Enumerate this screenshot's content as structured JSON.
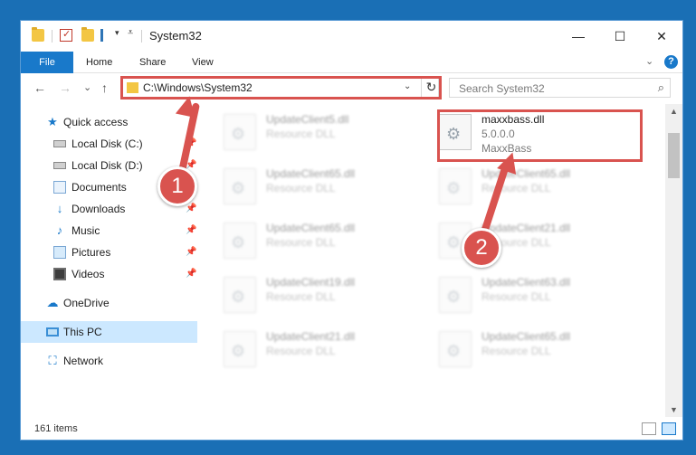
{
  "window": {
    "title": "System32",
    "controls": {
      "minimize": "—",
      "maximize": "☐",
      "close": "✕"
    }
  },
  "ribbon": {
    "tabs": [
      "File",
      "Home",
      "Share",
      "View"
    ],
    "chevron": "⌄",
    "help": "?"
  },
  "navbar": {
    "back": "←",
    "forward": "→",
    "recent": "⌄",
    "up": "↑",
    "address": "C:\\Windows\\System32",
    "address_dropdown": "⌄",
    "refresh": "↻",
    "search_placeholder": "Search System32",
    "search_icon": "⌕"
  },
  "sidebar": {
    "items": [
      {
        "label": "Quick access",
        "icon": "star-icon",
        "glyph": "★"
      },
      {
        "label": "Local Disk (C:)",
        "icon": "drive-icon",
        "glyph": "",
        "pinned": true
      },
      {
        "label": "Local Disk (D:)",
        "icon": "drive-icon",
        "glyph": "",
        "pinned": true
      },
      {
        "label": "Documents",
        "icon": "documents-icon",
        "glyph": "",
        "pinned": true
      },
      {
        "label": "Downloads",
        "icon": "download-icon",
        "glyph": "↓",
        "pinned": true
      },
      {
        "label": "Music",
        "icon": "music-icon",
        "glyph": "♪",
        "pinned": true
      },
      {
        "label": "Pictures",
        "icon": "pictures-icon",
        "glyph": "",
        "pinned": true
      },
      {
        "label": "Videos",
        "icon": "videos-icon",
        "glyph": "",
        "pinned": true
      },
      {
        "label": "OneDrive",
        "icon": "cloud-icon",
        "glyph": "☁"
      },
      {
        "label": "This PC",
        "icon": "computer-icon",
        "glyph": "",
        "selected": true
      },
      {
        "label": "Network",
        "icon": "network-icon",
        "glyph": "⛶"
      }
    ],
    "pin_glyph": "📌"
  },
  "files": {
    "left": [
      {
        "name": "UpdateClient5.dll",
        "type": "Resource DLL"
      },
      {
        "name": "UpdateClient65.dll",
        "type": "Resource DLL"
      },
      {
        "name": "UpdateClient65.dll",
        "type": "Resource DLL"
      },
      {
        "name": "UpdateClient19.dll",
        "type": "Resource DLL"
      },
      {
        "name": "UpdateClient21.dll",
        "type": "Resource DLL"
      }
    ],
    "right": [
      {
        "name": "maxxbass.dll",
        "type": "5.0.0.0",
        "extra": "MaxxBass"
      },
      {
        "name": "UpdateClient65.dll",
        "type": "Resource DLL"
      },
      {
        "name": "UpdateClient21.dll",
        "type": "Resource DLL"
      },
      {
        "name": "UpdateClient63.dll",
        "type": "Resource DLL"
      },
      {
        "name": "UpdateClient65.dll",
        "type": "Resource DLL"
      }
    ]
  },
  "scrollbar": {
    "up": "▲",
    "down": "▼",
    "thumb_position": 0.06
  },
  "status": {
    "count": "161 items"
  },
  "annotations": {
    "badge_1": "1",
    "badge_2": "2",
    "color": "#d9534f"
  }
}
